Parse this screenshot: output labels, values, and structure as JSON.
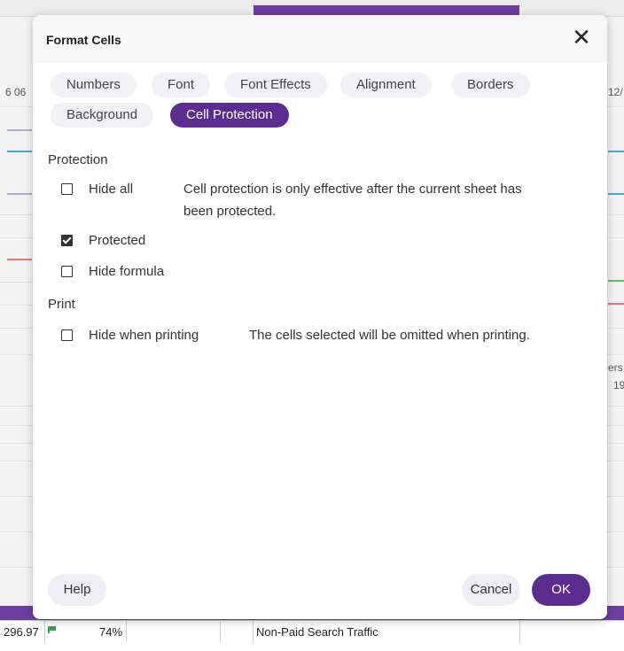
{
  "background": {
    "left_edge_labels": [
      "6 06"
    ],
    "right_edge_labels": [
      "12/",
      "ers",
      "19"
    ],
    "bottom_row": {
      "value": "296.97",
      "percent": "74%",
      "label": "Non-Paid Search Traffic"
    },
    "accent_colors": {
      "purple": "#6b3fa0",
      "blue": "#4aa3d8",
      "red": "#e07a7a",
      "green": "#6bbf6b",
      "lavender": "#b6a6d6"
    }
  },
  "dialog": {
    "title": "Format Cells",
    "close_icon": "close-icon",
    "tabs": [
      {
        "label": "Numbers",
        "active": false
      },
      {
        "label": "Font",
        "active": false
      },
      {
        "label": "Font Effects",
        "active": false
      },
      {
        "label": "Alignment",
        "active": false
      },
      {
        "label": "Borders",
        "active": false
      },
      {
        "label": "Background",
        "active": false
      },
      {
        "label": "Cell Protection",
        "active": true
      }
    ],
    "protection": {
      "heading": "Protection",
      "hide_all": {
        "label": "Hide all",
        "checked": false
      },
      "note_line1": "Cell protection is only effective after the current sheet has",
      "note_line2": "been protected.",
      "protected": {
        "label": "Protected",
        "checked": true
      },
      "hide_formula": {
        "label": "Hide formula",
        "checked": false
      }
    },
    "print": {
      "heading": "Print",
      "hide_when_printing": {
        "label": "Hide when printing",
        "checked": false
      },
      "note": "The cells selected will be omitted when printing."
    },
    "buttons": {
      "help": "Help",
      "cancel": "Cancel",
      "ok": "OK"
    },
    "accent": "#5c2d91"
  }
}
